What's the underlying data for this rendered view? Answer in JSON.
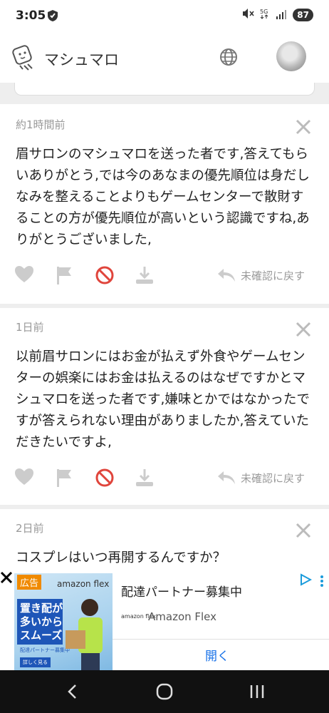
{
  "status_bar": {
    "time": "3:05",
    "battery": "87"
  },
  "header": {
    "title": "マシュマロ"
  },
  "messages": [
    {
      "time": "約1時間前",
      "text": "眉サロンのマシュマロを送った者です,答えてもらいありがとう,では今のあなまの優先順位は身だしなみを整えることよりもゲームセンターで散財することの方が優先順位が高いという認識ですね,ありがとうございました,",
      "unconfirm_label": "未確認に戻す"
    },
    {
      "time": "1日前",
      "text": "以前眉サロンにはお金が払えず外食やゲームセンターの娯楽にはお金は払えるのはなぜですかとマシュマロを送った者です,嫌味とかではなかったですが答えられない理由がありましたか,答えていただきたいですよ,",
      "unconfirm_label": "未確認に戻す"
    },
    {
      "time": "2日前",
      "text": "コスプレはいつ再開するんですか？"
    }
  ],
  "ad": {
    "badge": "広告",
    "image_brand": "amazon flex",
    "image_copy": "置き配が\n多いから\nスムーズ",
    "image_small": "配達パートナー募集中",
    "image_button": "詳しく見る",
    "headline": "配達パートナー募集中",
    "logo_text": "amazon flex",
    "advertiser": "Amazon Flex",
    "open_label": "開く"
  },
  "colors": {
    "icon_gray": "#cccccc",
    "block_red": "#e0453c",
    "link_blue": "#1a73e8",
    "ad_orange": "#f08a00"
  }
}
